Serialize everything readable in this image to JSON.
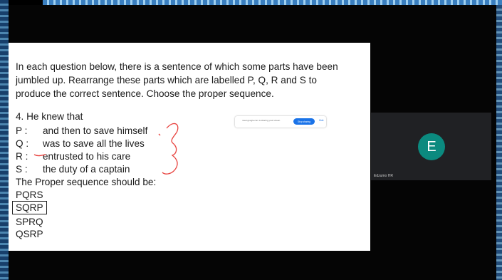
{
  "slide": {
    "instruction": "In each question below, there is a sentence of which some parts have been jumbled up. Rearrange these parts which are labelled P, Q, R and S to produce the correct sentence. Choose the proper sequence.",
    "question": "4. He knew that",
    "parts": [
      {
        "label": "P :",
        "text": "and then to save himself"
      },
      {
        "label": "Q :",
        "text": "was to save all the lives"
      },
      {
        "label": "R :",
        "text": "entrusted to his care"
      },
      {
        "label": "S :",
        "text": "the duty of a captain"
      }
    ],
    "sequence_label": "The Proper sequence should be:",
    "options": [
      "PQRS",
      "SQRP",
      "SPRQ",
      "QSRP"
    ],
    "selected_option": "SQRP"
  },
  "share_banner": {
    "text": "meet.google.com is sharing your screen.",
    "stop_label": "Stop sharing",
    "hide_label": "Hide"
  },
  "participant": {
    "initial": "E",
    "name": "Edzumo HR",
    "avatar_color": "#0b8a7f"
  }
}
